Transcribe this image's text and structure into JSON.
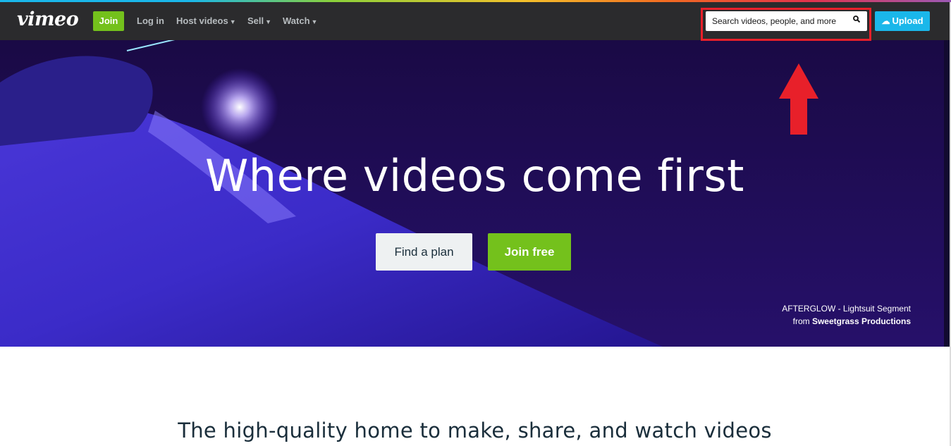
{
  "nav": {
    "logo": "vimeo",
    "join_label": "Join",
    "login_label": "Log in",
    "items": [
      {
        "label": "Host videos"
      },
      {
        "label": "Sell"
      },
      {
        "label": "Watch"
      }
    ],
    "search_placeholder": "Search videos, people, and more",
    "upload_label": "Upload"
  },
  "hero": {
    "title": "Where videos come first",
    "find_plan_label": "Find a plan",
    "join_free_label": "Join free",
    "credit_line1": "AFTERGLOW - Lightsuit Segment",
    "credit_from": "from",
    "credit_producer": "Sweetgrass Productions"
  },
  "section": {
    "heading": "The high-quality home to make, share, and watch videos"
  },
  "colors": {
    "brand_green": "#74c11c",
    "brand_blue": "#1ab7ea",
    "annotation_red": "#e8202a",
    "topbar": "#2b2b2d"
  }
}
